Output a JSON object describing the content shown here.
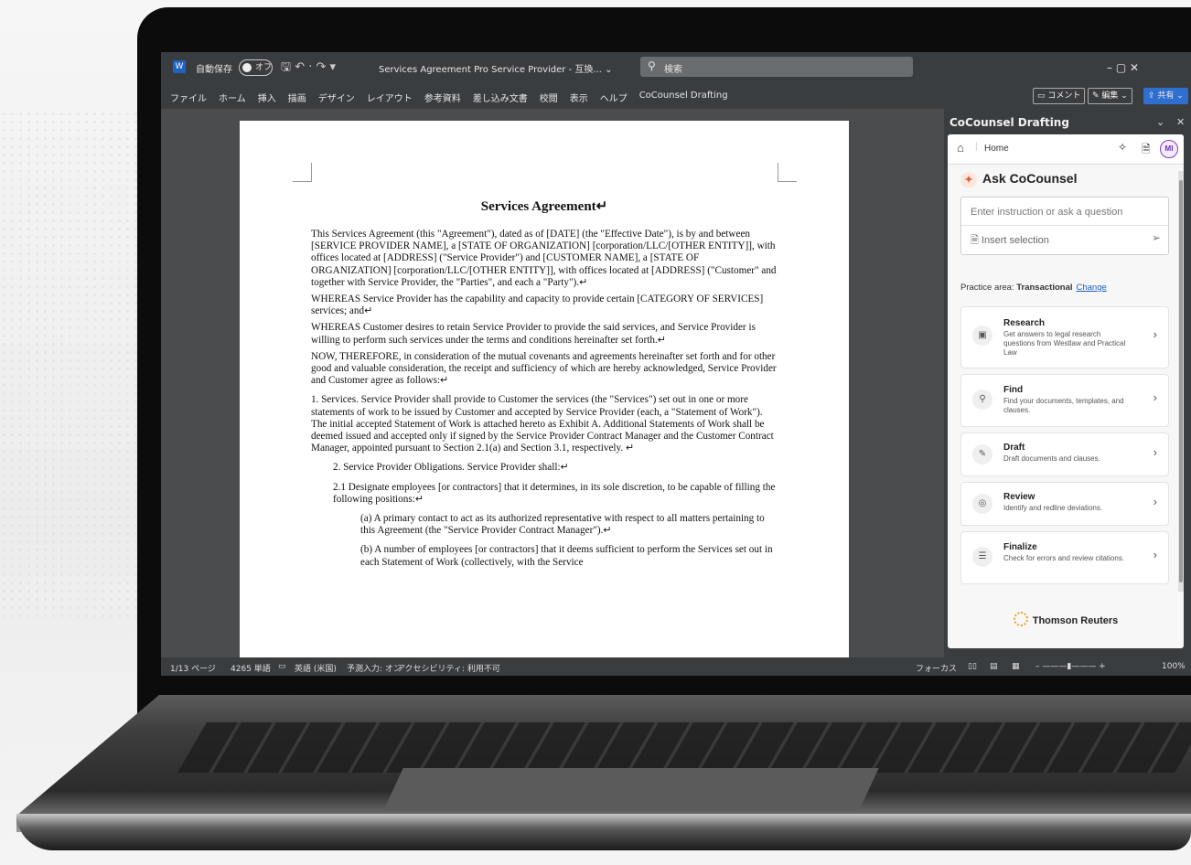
{
  "titlebar": {
    "app_icon": "W",
    "autosave_label": "自動保存",
    "toggle_state": "オフ",
    "doc_title": "Services Agreement Pro Service Provider - 互換... ⌄",
    "search_placeholder": "検索",
    "quick_access": "🖫  ↶ · ↷  ▾",
    "window_controls": "–     ▢     ✕"
  },
  "ribbon": {
    "tabs": [
      "ファイル",
      "ホーム",
      "挿入",
      "描画",
      "デザイン",
      "レイアウト",
      "参考資料",
      "差し込み文書",
      "校閲",
      "表示",
      "ヘルプ",
      "CoCounsel Drafting"
    ],
    "comment_label": "コメント",
    "edit_label": "編集 ⌄",
    "share_label": "共有 ⌄"
  },
  "document": {
    "title": "Services Agreement↵",
    "paragraphs": [
      "This Services Agreement (this \"Agreement\"), dated as of [DATE] (the \"Effective Date\"), is by and between [SERVICE PROVIDER NAME], a [STATE OF ORGANIZATION] [corporation/LLC/[OTHER ENTITY]], with offices located at [ADDRESS] (\"Service Provider\") and [CUSTOMER NAME], a [STATE OF ORGANIZATION] [corporation/LLC/[OTHER ENTITY]], with offices located at [ADDRESS] (\"Customer\" and together with Service Provider, the \"Parties\", and each a \"Party\").↵",
      "WHEREAS Service Provider has the capability and capacity to provide certain [CATEGORY OF SERVICES] services; and↵",
      "WHEREAS Customer desires to retain Service Provider to provide the said services, and Service Provider is willing to perform such services under the terms and conditions hereinafter set forth.↵",
      "NOW, THEREFORE, in consideration of the mutual covenants and agreements hereinafter set forth and for other good and valuable consideration, the receipt and sufficiency of which are hereby acknowledged, Service Provider and Customer agree as follows:↵",
      "1.      Services. Service Provider shall provide to Customer the services (the \"Services\") set out in one or more statements of work to be issued by Customer and accepted by Service Provider (each, a \"Statement of Work\"). The initial accepted Statement of Work is attached hereto as Exhibit A. Additional Statements of Work shall be deemed issued and accepted only if signed by the Service Provider Contract Manager and the Customer Contract Manager, appointed pursuant to Section 2.1(a) and Section 3.1, respectively. ↵",
      "2.      Service Provider Obligations. Service Provider shall:↵",
      "2.1      Designate employees [or contractors] that it determines, in its sole discretion, to be capable of filling the following positions:↵",
      "(a)      A primary contact to act as its authorized representative with respect to all matters pertaining to this Agreement (the \"Service Provider Contract Manager\").↵",
      "(b)      A number of employees [or contractors] that it deems sufficient to perform the Services set out in each Statement of Work (collectively, with the Service"
    ]
  },
  "statusbar": {
    "page": "1/13 ページ",
    "words": "4265 単語",
    "language": "英語 (米国)",
    "predict": "予測入力: オン",
    "accessibility": "アクセシビリティ: 利用不可",
    "focus": "フォーカス",
    "zoom": "100%"
  },
  "pane": {
    "title": "CoCounsel Drafting",
    "home_label": "Home",
    "avatar": "MI",
    "ask_title": "Ask CoCounsel",
    "input_placeholder": "Enter instruction or ask a question",
    "insert_selection": "Insert selection",
    "practice_prefix": "Practice area: ",
    "practice_value": "Transactional",
    "practice_change": "Change",
    "cards": [
      {
        "title": "Research",
        "desc": "Get answers to legal research questions from Westlaw and Practical Law",
        "icon": "research-icon"
      },
      {
        "title": "Find",
        "desc": "Find your documents, templates, and clauses.",
        "icon": "search-icon"
      },
      {
        "title": "Draft",
        "desc": "Draft documents and clauses.",
        "icon": "edit-icon"
      },
      {
        "title": "Review",
        "desc": "Identify and redline deviations.",
        "icon": "review-icon"
      },
      {
        "title": "Finalize",
        "desc": "Check for errors and review citations.",
        "icon": "checklist-icon"
      }
    ],
    "footer_brand": "Thomson Reuters"
  },
  "colors": {
    "accent": "#2f6fd0",
    "cocounsel_orange": "#e2582d",
    "brand_logo": "#f29c1f"
  }
}
